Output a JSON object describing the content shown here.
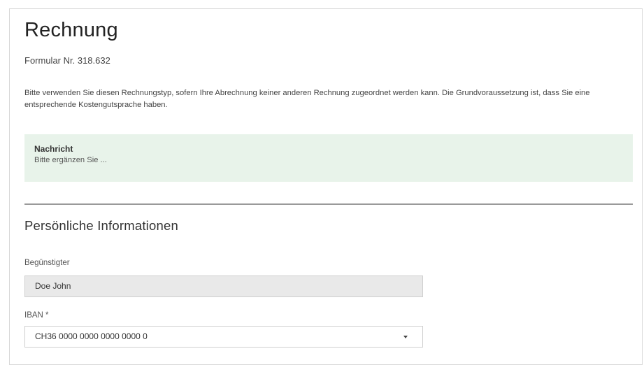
{
  "header": {
    "title": "Rechnung",
    "form_number": "Formular Nr. 318.632"
  },
  "intro_text": "Bitte verwenden Sie diesen Rechnungstyp, sofern Ihre Abrechnung keiner anderen Rechnung zugeordnet werden kann. Die Grundvoraussetzung ist, dass Sie eine entsprechende Kostengutsprache haben.",
  "notice": {
    "title": "Nachricht",
    "text": "Bitte ergänzen Sie ..."
  },
  "section": {
    "heading": "Persönliche Informationen"
  },
  "fields": {
    "beneficiary": {
      "label": "Begünstigter",
      "value": "Doe John"
    },
    "iban": {
      "label": "IBAN *",
      "value": "CH36 0000 0000 0000 0000 0",
      "icon": "chevron-down-icon"
    }
  },
  "colors": {
    "notice_background": "#e8f3ea",
    "readonly_background": "#e9e9e9",
    "divider": "#9a9a9a"
  }
}
